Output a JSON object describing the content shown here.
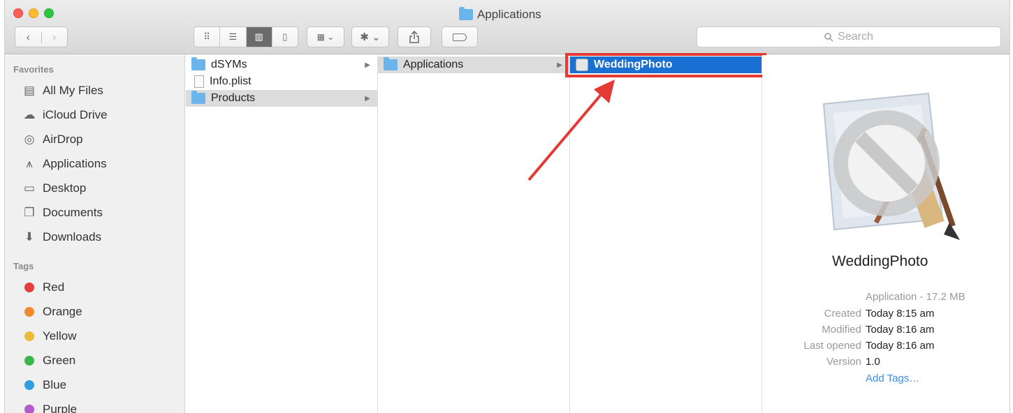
{
  "window": {
    "title": "Applications"
  },
  "toolbar": {
    "back": "‹",
    "forward": "›",
    "search_placeholder": "Search"
  },
  "sidebar": {
    "favorites_title": "Favorites",
    "favorites": [
      {
        "label": "All My Files",
        "icon": "all-files-icon"
      },
      {
        "label": "iCloud Drive",
        "icon": "cloud-icon"
      },
      {
        "label": "AirDrop",
        "icon": "airdrop-icon"
      },
      {
        "label": "Applications",
        "icon": "applications-icon"
      },
      {
        "label": "Desktop",
        "icon": "desktop-icon"
      },
      {
        "label": "Documents",
        "icon": "documents-icon"
      },
      {
        "label": "Downloads",
        "icon": "downloads-icon"
      }
    ],
    "tags_title": "Tags",
    "tags": [
      {
        "label": "Red",
        "color": "#e53c3c"
      },
      {
        "label": "Orange",
        "color": "#f08a2e"
      },
      {
        "label": "Yellow",
        "color": "#ecbb3a"
      },
      {
        "label": "Green",
        "color": "#3cb54a"
      },
      {
        "label": "Blue",
        "color": "#2f9ee0"
      },
      {
        "label": "Purple",
        "color": "#b25ccb"
      }
    ]
  },
  "columns": [
    {
      "items": [
        {
          "name": "dSYMs",
          "type": "folder"
        },
        {
          "name": "Info.plist",
          "type": "file"
        },
        {
          "name": "Products",
          "type": "folder"
        }
      ]
    },
    {
      "items": [
        {
          "name": "Applications",
          "type": "folder"
        }
      ]
    },
    {
      "items": [
        {
          "name": "WeddingPhoto",
          "type": "app"
        }
      ]
    }
  ],
  "preview": {
    "name": "WeddingPhoto",
    "kind": "Application - 17.2 MB",
    "created_label": "Created",
    "created": "Today 8:15 am",
    "modified_label": "Modified",
    "modified": "Today 8:16 am",
    "last_opened_label": "Last opened",
    "last_opened": "Today 8:16 am",
    "version_label": "Version",
    "version": "1.0",
    "add_tags": "Add Tags…"
  }
}
